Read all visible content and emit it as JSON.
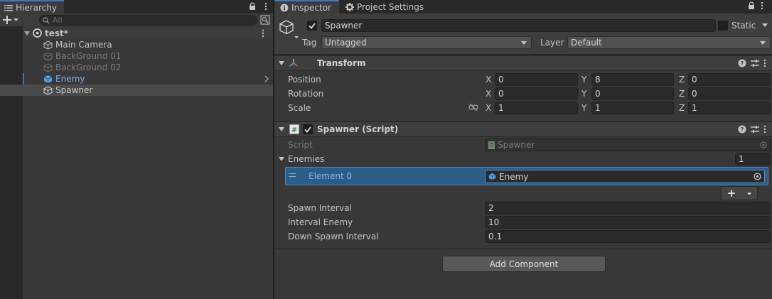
{
  "hierarchy": {
    "tab_label": "Hierarchy",
    "search_placeholder": "All",
    "scene_name": "test*",
    "items": [
      {
        "label": "Main Camera",
        "state": "normal"
      },
      {
        "label": "BackGround 01",
        "state": "inactive"
      },
      {
        "label": "BackGround 02",
        "state": "inactive"
      },
      {
        "label": "Enemy",
        "state": "prefab"
      },
      {
        "label": "Spawner",
        "state": "selected"
      }
    ]
  },
  "inspector": {
    "tab_label": "Inspector",
    "project_settings_label": "Project Settings",
    "object_name": "Spawner",
    "active": true,
    "static_label": "Static",
    "tag_label": "Tag",
    "tag_value": "Untagged",
    "layer_label": "Layer",
    "layer_value": "Default",
    "transform": {
      "title": "Transform",
      "position_label": "Position",
      "rotation_label": "Rotation",
      "scale_label": "Scale",
      "axis_x": "X",
      "axis_y": "Y",
      "axis_z": "Z",
      "position": {
        "x": "0",
        "y": "8",
        "z": "0"
      },
      "rotation": {
        "x": "0",
        "y": "0",
        "z": "0"
      },
      "scale": {
        "x": "1",
        "y": "1",
        "z": "1"
      }
    },
    "script_component": {
      "title": "Spawner (Script)",
      "enabled": true,
      "script_label": "Script",
      "script_value": "Spawner",
      "enemies_label": "Enemies",
      "enemies_count": "1",
      "element_label": "Element 0",
      "element_value": "Enemy",
      "plus_label": "+",
      "minus_label": "-",
      "spawn_interval_label": "Spawn Interval",
      "spawn_interval_value": "2",
      "interval_enemy_label": "Interval Enemy",
      "interval_enemy_value": "10",
      "down_spawn_label": "Down Spawn Interval",
      "down_spawn_value": "0.1"
    },
    "add_component_label": "Add Component"
  },
  "colors": {
    "accent": "#3a79bb",
    "prefab_text": "#7baeea",
    "selected_row": "#2c5d87"
  }
}
